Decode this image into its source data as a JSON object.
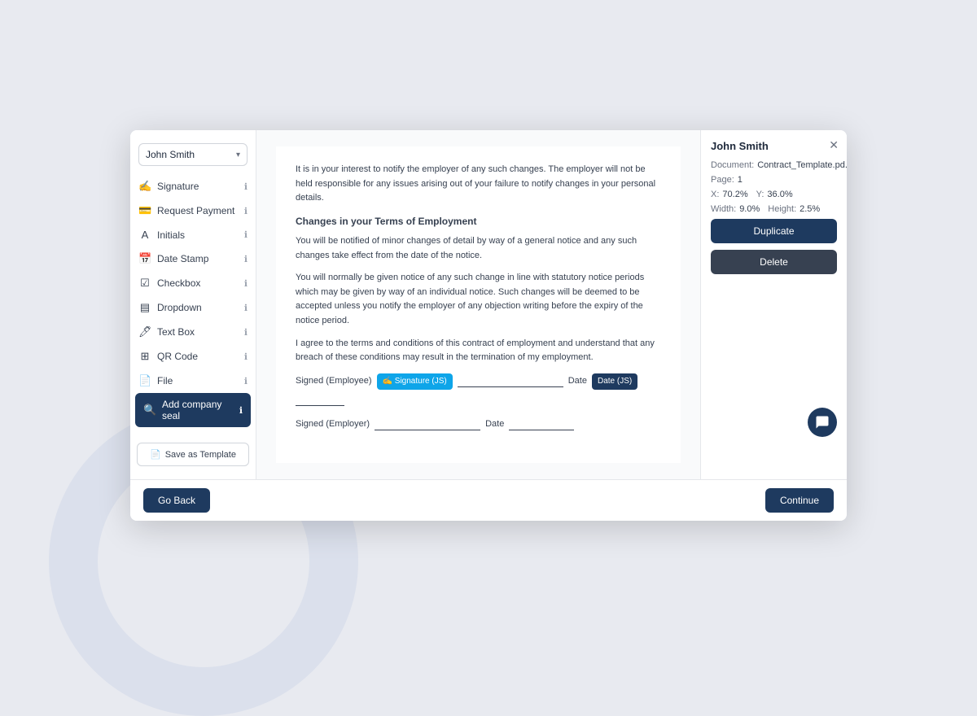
{
  "background": {
    "circle_color": "rgba(200,210,230,0.4)"
  },
  "user_selector": {
    "name": "John Smith",
    "chevron": "▾"
  },
  "sidebar": {
    "items": [
      {
        "id": "signature",
        "icon": "✍",
        "label": "Signature",
        "info": "ℹ"
      },
      {
        "id": "request-payment",
        "icon": "💳",
        "label": "Request Payment",
        "info": "ℹ"
      },
      {
        "id": "initials",
        "icon": "A",
        "label": "Initials",
        "info": "ℹ"
      },
      {
        "id": "date-stamp",
        "icon": "📅",
        "label": "Date Stamp",
        "info": "ℹ"
      },
      {
        "id": "checkbox",
        "icon": "☑",
        "label": "Checkbox",
        "info": "ℹ"
      },
      {
        "id": "dropdown",
        "icon": "▤",
        "label": "Dropdown",
        "info": "ℹ"
      },
      {
        "id": "text-box",
        "icon": "🖊",
        "label": "Text Box",
        "info": "ℹ"
      },
      {
        "id": "qr-code",
        "icon": "⊞",
        "label": "QR Code",
        "info": "ℹ"
      },
      {
        "id": "file",
        "icon": "📄",
        "label": "File",
        "info": "ℹ"
      },
      {
        "id": "add-company-seal",
        "icon": "🔍",
        "label": "Add company seal",
        "info": "ℹ",
        "active": true
      }
    ],
    "save_template_label": "Save as Template"
  },
  "document": {
    "intro_text": "It is in your interest to notify the employer of any such changes. The employer will not be held responsible for any issues arising out of your failure to notify changes in your personal details.",
    "section_title": "Changes in your Terms of Employment",
    "para1": "You will be notified of minor changes of detail by way of a general notice and any such changes take effect from the date of the notice.",
    "para2": "You will normally be given notice of any such change in line with statutory notice periods which may be given by way of an individual notice. Such changes will be deemed to be accepted unless you notify the employer of any objection writing before the expiry of the notice period.",
    "para3": "I agree to the terms and conditions of this contract of employment and understand that any breach of these conditions may result in the termination of my employment.",
    "signed_employee_label": "Signed (Employee)",
    "signed_employer_label": "Signed (Employer)",
    "date_label_1": "Date",
    "date_label_2": "Date",
    "signature_badge": "✍ Signature (JS)",
    "date_badge": "Date (JS)"
  },
  "right_panel": {
    "name": "John Smith",
    "document_label": "Document:",
    "document_value": "Contract_Template.pd...",
    "page_label": "Page:",
    "page_value": "1",
    "x_label": "X:",
    "x_value": "70.2%",
    "y_label": "Y:",
    "y_value": "36.0%",
    "width_label": "Width:",
    "width_value": "9.0%",
    "height_label": "Height:",
    "height_value": "2.5%",
    "duplicate_btn": "Duplicate",
    "delete_btn": "Delete"
  },
  "footer": {
    "go_back": "Go Back",
    "continue": "Continue"
  }
}
